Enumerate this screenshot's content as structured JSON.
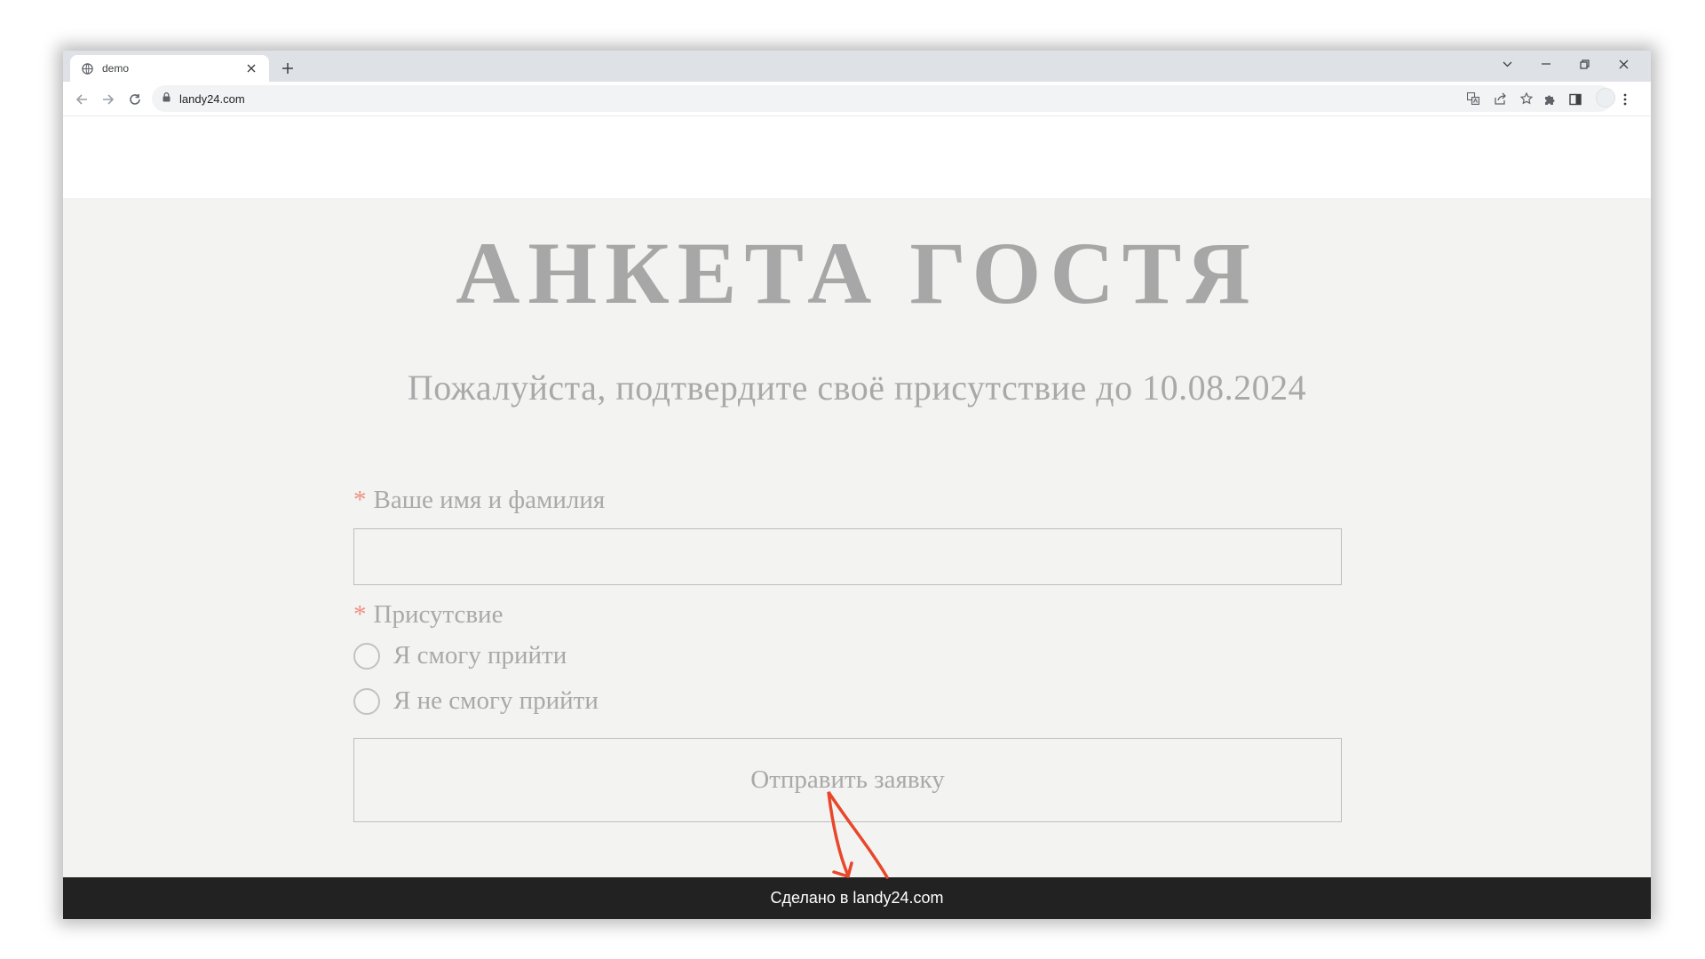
{
  "browser": {
    "tab_title": "demo",
    "url": "landy24.com"
  },
  "page": {
    "title": "АНКЕТА ГОСТЯ",
    "subtitle": "Пожалуйста, подтвердите своё присутствие до 10.08.2024",
    "required_mark": "*",
    "name_field": {
      "label": "Ваше имя и фамилия",
      "value": ""
    },
    "attendance": {
      "label": "Присутсвие",
      "options": [
        "Я смогу прийти",
        "Я не смогу прийти"
      ]
    },
    "submit_label": "Отправить заявку",
    "footer_text": "Сделано в landy24.com"
  },
  "colors": {
    "accent_required": "#f08f80",
    "footer_bg": "#222222",
    "annotation_arrow": "#e8472b"
  },
  "icons": [
    "globe-icon",
    "close-icon",
    "plus-icon",
    "chevron-down-icon",
    "minimize-icon",
    "restore-icon",
    "back-icon",
    "forward-icon",
    "reload-icon",
    "lock-icon",
    "translate-icon",
    "share-icon",
    "star-icon",
    "puzzle-icon",
    "side-panel-icon",
    "kebab-menu-icon"
  ]
}
